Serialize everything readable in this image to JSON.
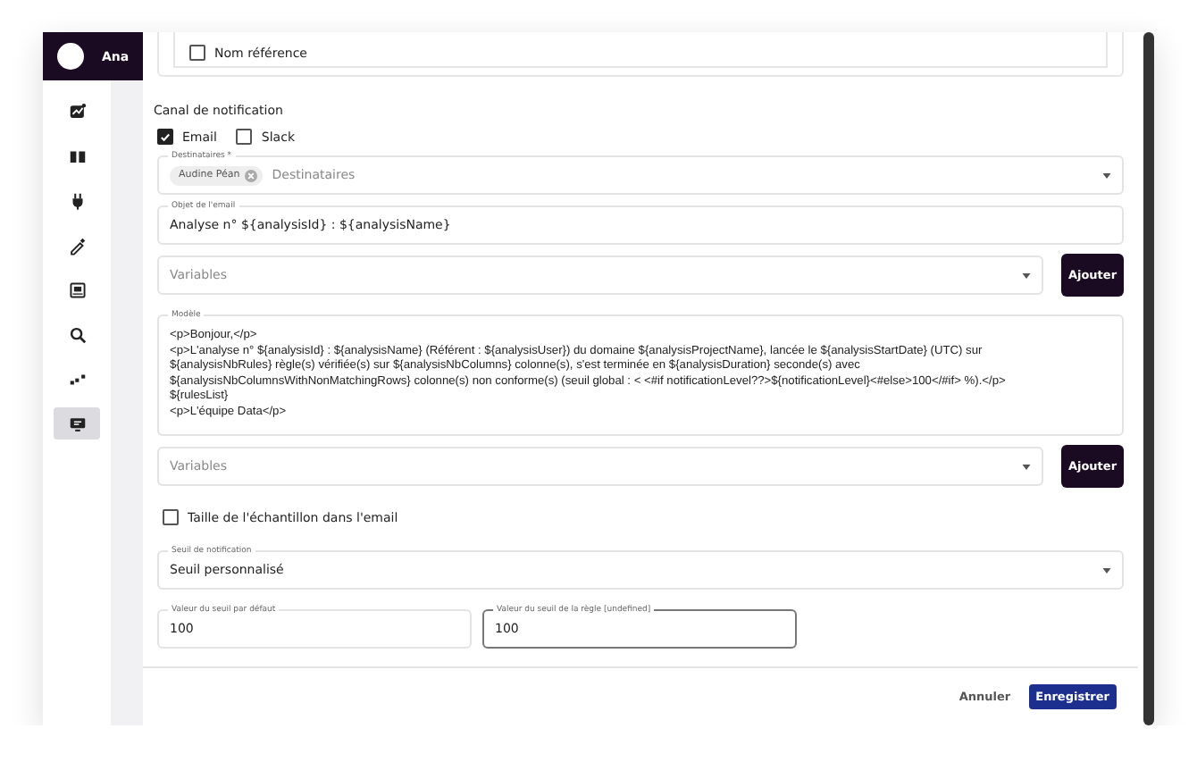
{
  "header": {
    "title": "Ana"
  },
  "sidebar": {
    "items": [
      {
        "selected": false
      },
      {
        "selected": false
      },
      {
        "selected": false
      },
      {
        "selected": false
      },
      {
        "selected": false
      },
      {
        "selected": false
      },
      {
        "selected": false
      },
      {
        "selected": true
      }
    ]
  },
  "list": {
    "items": [
      {
        "label": "Nom référence",
        "checked": false
      }
    ]
  },
  "notification_channel": {
    "title": "Canal de notification",
    "options": [
      {
        "label": "Email",
        "checked": true
      },
      {
        "label": "Slack",
        "checked": false
      }
    ]
  },
  "recipients": {
    "label": "Destinataires *",
    "chips": [
      "Audine Péan"
    ],
    "placeholder": "Destinataires"
  },
  "subject": {
    "label": "Objet de l'email",
    "value": "Analyse n° ${analysisId} : ${analysisName}"
  },
  "variables_top": {
    "placeholder": "Variables",
    "button": "Ajouter"
  },
  "template": {
    "label": "Modèle",
    "lines": [
      "<p>Bonjour,</p>",
      "<p>L'analyse n° ${analysisId} : ${analysisName} (Référent : ${analysisUser}) du domaine ${analysisProjectName}, lancée le ${analysisStartDate} (UTC) sur",
      "${analysisNbRules} règle(s) vérifiée(s) sur ${analysisNbColumns} colonne(s), s'est terminée en ${analysisDuration} seconde(s) avec",
      "${analysisNbColumnsWithNonMatchingRows} colonne(s) non conforme(s) (seuil global : < <#if notificationLevel??>${notificationLevel}<#else>100</#if> %).</p>",
      "${rulesList}",
      "<p>L'équipe Data</p>"
    ]
  },
  "variables_bottom": {
    "placeholder": "Variables",
    "button": "Ajouter"
  },
  "sample_size": {
    "label": "Taille de l'échantillon dans l'email",
    "checked": false
  },
  "threshold": {
    "label": "Seuil de notification",
    "value": "Seuil personnalisé"
  },
  "threshold_values": [
    {
      "label": "Valeur du seuil par défaut",
      "value": "100",
      "focused": false
    },
    {
      "label": "Valeur du seuil de la règle [undefined]",
      "value": "100",
      "focused": true
    }
  ],
  "footer": {
    "cancel": "Annuler",
    "save": "Enregistrer"
  }
}
